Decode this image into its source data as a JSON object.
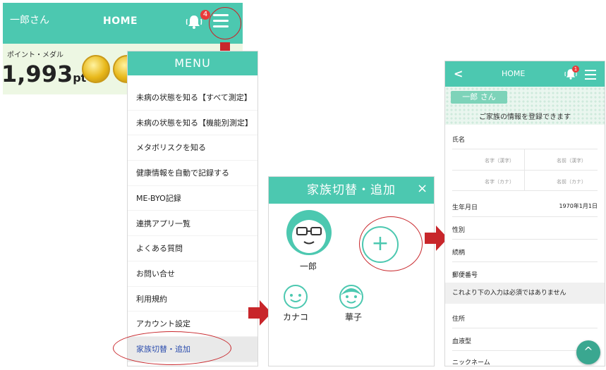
{
  "screen1": {
    "user_label": "一郎さん",
    "title": "HOME",
    "notification_count": "4",
    "points_label": "ポイント・メダル",
    "points_value": "1,993",
    "points_unit": "pt"
  },
  "menu": {
    "title": "MENU",
    "items": [
      {
        "label": "未病の状態を知る【すべて測定】"
      },
      {
        "label": "未病の状態を知る【機能別測定】"
      },
      {
        "label": "メタボリスクを知る"
      },
      {
        "label": "健康情報を自動で記録する"
      },
      {
        "label": "ME-BYO記録"
      },
      {
        "label": "連携アプリ一覧"
      },
      {
        "label": "よくある質問"
      },
      {
        "label": "お問い合せ"
      },
      {
        "label": "利用規約"
      },
      {
        "label": "アカウント設定"
      },
      {
        "label": "家族切替・追加"
      }
    ]
  },
  "family": {
    "title": "家族切替・追加",
    "close": "×",
    "add": "+",
    "members": [
      {
        "name": "一郎"
      },
      {
        "name": "カナコ"
      },
      {
        "name": "華子"
      }
    ]
  },
  "register": {
    "back": "<",
    "title": "HOME",
    "notification_count": "1",
    "user_label": "一郎 さん",
    "notice": "ご家族の情報を登録できます",
    "name_label": "氏名",
    "last_kanji": "名字（漢字）",
    "first_kanji": "名前（漢字）",
    "last_kana": "名字（カナ）",
    "first_kana": "名前（カナ）",
    "birth_label": "生年月日",
    "birth_value": "1970年1月1日",
    "gender_label": "性別",
    "relation_label": "続柄",
    "postal_label": "郵便番号",
    "optional_notice": "これより下の入力は必須ではありません",
    "address_label": "住所",
    "blood_label": "血液型",
    "nickname_label": "ニックネーム",
    "fab": "^"
  },
  "colors": {
    "primary": "#4cc8b0",
    "highlight": "#c8262b",
    "badge": "#e83a3a"
  }
}
